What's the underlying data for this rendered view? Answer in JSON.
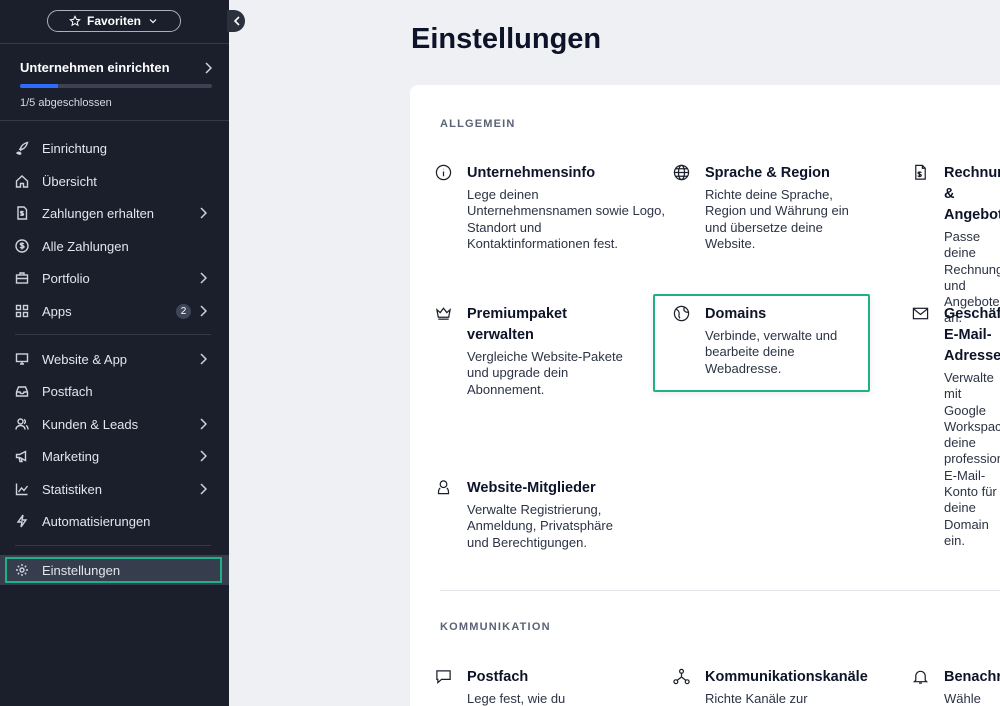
{
  "sidebar": {
    "favorites_label": "Favoriten",
    "setup": {
      "title": "Unternehmen einrichten",
      "progress_text": "1/5 abgeschlossen",
      "progress_fraction": 0.2
    },
    "items": [
      {
        "label": "Einrichtung",
        "icon": "rocket-icon",
        "chevron": false
      },
      {
        "label": "Übersicht",
        "icon": "home-icon",
        "chevron": false
      },
      {
        "label": "Zahlungen erhalten",
        "icon": "invoice-icon",
        "chevron": true
      },
      {
        "label": "Alle Zahlungen",
        "icon": "dollar-icon",
        "chevron": false
      },
      {
        "label": "Portfolio",
        "icon": "portfolio-icon",
        "chevron": true
      },
      {
        "label": "Apps",
        "icon": "apps-icon",
        "chevron": true,
        "badge": "2"
      },
      {
        "label": "Website & App",
        "icon": "monitor-icon",
        "chevron": true
      },
      {
        "label": "Postfach",
        "icon": "inbox-icon",
        "chevron": false
      },
      {
        "label": "Kunden & Leads",
        "icon": "people-icon",
        "chevron": true
      },
      {
        "label": "Marketing",
        "icon": "megaphone-icon",
        "chevron": true
      },
      {
        "label": "Statistiken",
        "icon": "chart-icon",
        "chevron": true
      },
      {
        "label": "Automatisierungen",
        "icon": "bolt-icon",
        "chevron": false
      },
      {
        "label": "Einstellungen",
        "icon": "gear-icon",
        "chevron": false,
        "active": true
      }
    ]
  },
  "main": {
    "title": "Einstellungen",
    "sections": [
      {
        "label": "ALLGEMEIN",
        "tiles": [
          {
            "title": "Unternehmensinfo",
            "desc": "Lege deinen Unternehmensnamen sowie Logo, Standort und Kontaktinformationen fest."
          },
          {
            "title": "Sprache & Region",
            "desc": "Richte deine Sprache, Region und Währung ein und übersetze deine Website."
          },
          {
            "title": "Rechnungen & Angebote",
            "desc": "Passe deine Rechnungen und Angebote an."
          },
          {
            "title": "Premiumpaket verwalten",
            "desc": "Vergleiche Website-Pakete und upgrade dein Abonnement."
          },
          {
            "title": "Domains",
            "desc": "Verbinde, verwalte und bearbeite deine Webadresse."
          },
          {
            "title": "Geschäftliche E-Mail-Adressen",
            "desc": "Verwalte mit Google Workspace deine professionelle E-Mail-Konto für deine Domain ein."
          },
          {
            "title": "Website-Mitglieder",
            "desc": "Verwalte Registrierung, Anmeldung, Privatsphäre und Berechtigungen."
          }
        ]
      },
      {
        "label": "KOMMUNIKATION",
        "tiles": [
          {
            "title": "Postfach",
            "desc": "Lege fest, wie du"
          },
          {
            "title": "Kommunikationskanäle",
            "desc": "Richte Kanäle zur"
          },
          {
            "title": "Benachrichtigungen",
            "desc": "Wähle wer"
          }
        ]
      }
    ]
  }
}
